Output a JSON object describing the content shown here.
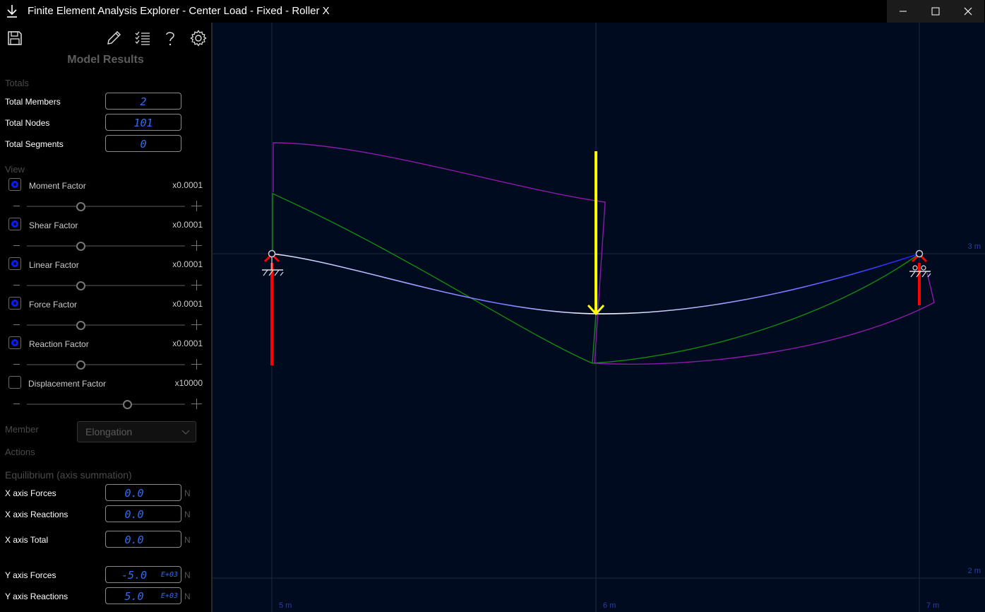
{
  "window": {
    "title": "Finite Element Analysis Explorer - Center Load - Fixed - Roller X"
  },
  "panel": {
    "title": "Model Results",
    "totals_heading": "Totals",
    "totals": [
      {
        "label": "Total Members",
        "value": "2"
      },
      {
        "label": "Total Nodes",
        "value": "101"
      },
      {
        "label": "Total Segments",
        "value": "0"
      }
    ],
    "view_heading": "View",
    "factors": [
      {
        "label": "Moment Factor",
        "value": "x0.0001",
        "checked": true,
        "level": 0.33
      },
      {
        "label": "Shear Factor",
        "value": "x0.0001",
        "checked": true,
        "level": 0.33
      },
      {
        "label": "Linear Factor",
        "value": "x0.0001",
        "checked": true,
        "level": 0.33
      },
      {
        "label": "Force Factor",
        "value": "x0.0001",
        "checked": true,
        "level": 0.33
      },
      {
        "label": "Reaction Factor",
        "value": "x0.0001",
        "checked": true,
        "level": 0.33
      },
      {
        "label": "Displacement Factor",
        "value": "x10000",
        "checked": false,
        "level": 0.63
      }
    ],
    "member_heading": "Member",
    "member_select": "Elongation",
    "actions_heading": "Actions",
    "equilibrium_heading": "Equilibrium (axis summation)",
    "equilibrium": [
      {
        "label": "X axis Forces",
        "value": "0.0",
        "exp": "",
        "unit": "N"
      },
      {
        "label": "X axis Reactions",
        "value": "0.0",
        "exp": "",
        "unit": "N"
      },
      {
        "label": "X axis Total",
        "value": "0.0",
        "exp": "",
        "unit": "N"
      },
      {
        "label": "Y axis Forces",
        "value": "-5.0",
        "exp": "E+03",
        "unit": "N"
      },
      {
        "label": "Y axis Reactions",
        "value": "5.0",
        "exp": "E+03",
        "unit": "N"
      }
    ]
  },
  "canvas": {
    "grid_labels": {
      "y_top": "3 m",
      "y_bottom": "2 m",
      "x_left": "5 m",
      "x_mid": "6 m",
      "x_right": "7 m"
    }
  },
  "colors": {
    "background": "#000b1f",
    "moment": "#8a1aa8",
    "shear": "#128a12",
    "beam_left": "#6a6aff",
    "beam_right": "#1a1aff",
    "load": "#ffff00",
    "reaction": "#ff0000",
    "value_text": "#2f6cf0"
  },
  "icons": [
    "save-icon",
    "edit-pencil-icon",
    "checklist-icon",
    "help-icon",
    "settings-gear-icon",
    "download-icon"
  ]
}
